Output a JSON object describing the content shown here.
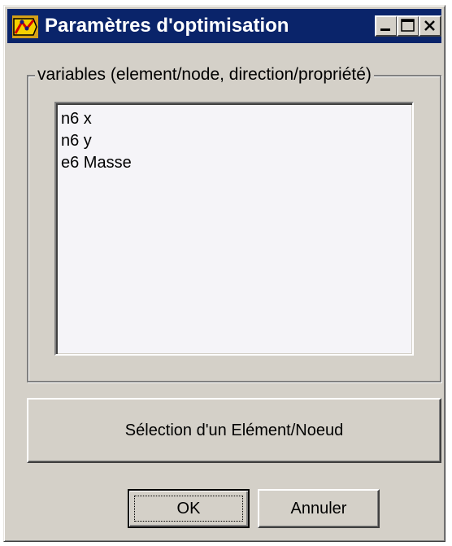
{
  "window": {
    "title": "Paramètres d'optimisation",
    "title_bar_color": "#0a246a",
    "face_color": "#d4d0c8",
    "controls": [
      "minimize-icon",
      "maximize-icon",
      "close-icon"
    ]
  },
  "group": {
    "label": "variables (element/node, direction/propriété)",
    "items": [
      "n6 x",
      "n6 y",
      "e6 Masse"
    ]
  },
  "buttons": {
    "select_label": "Sélection d'un Elément/Noeud",
    "ok_label": "OK",
    "cancel_label": "Annuler"
  }
}
